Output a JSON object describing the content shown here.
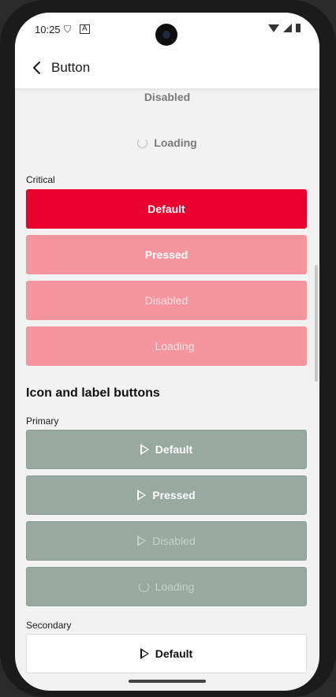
{
  "status_bar": {
    "time": "10:25"
  },
  "app_bar": {
    "title": "Button",
    "back_icon": "arrow-back-icon"
  },
  "top_section": {
    "disabled_text": "Disabled",
    "loading_text": "Loading"
  },
  "critical": {
    "label": "Critical",
    "buttons": [
      "Default",
      "Pressed",
      "Disabled",
      "Loading"
    ],
    "color": "#e8002f"
  },
  "icon_label": {
    "heading": "Icon and label buttons",
    "primary_label": "Primary",
    "primary_buttons": [
      "Default",
      "Pressed",
      "Disabled",
      "Loading"
    ],
    "primary_color": "#97a9a0",
    "secondary_label": "Secondary",
    "secondary_buttons": [
      "Default"
    ]
  }
}
